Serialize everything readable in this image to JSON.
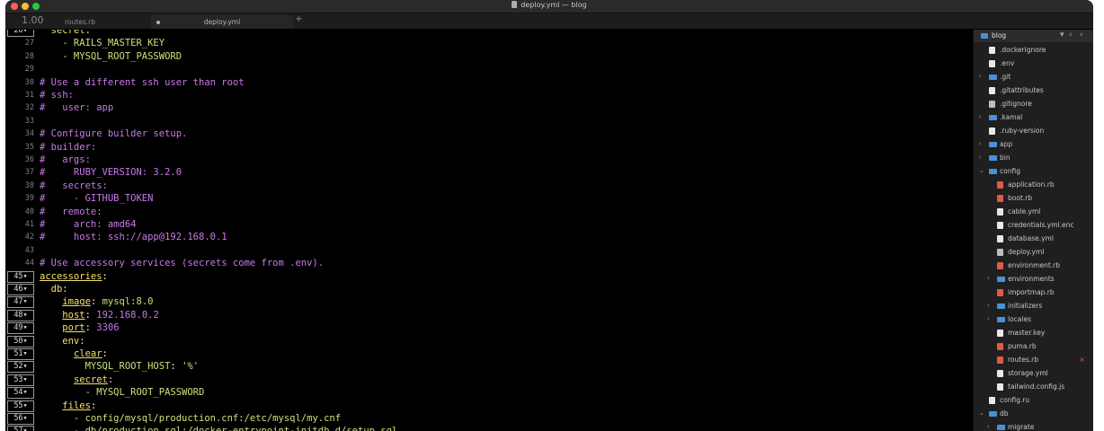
{
  "window": {
    "title": "deploy.yml — blog"
  },
  "tabs": {
    "zoom": "1.00",
    "items": [
      {
        "label": "routes.rb"
      },
      {
        "label": "deploy.yml"
      }
    ],
    "new_tab": "+"
  },
  "editor": {
    "lines": [
      {
        "n": "26",
        "fold": true,
        "segs": [
          {
            "c": "k",
            "t": "  secret"
          },
          {
            "c": "sv",
            "t": ":"
          }
        ]
      },
      {
        "n": "27",
        "segs": [
          {
            "c": "str",
            "t": "    - RAILS_MASTER_KEY"
          }
        ]
      },
      {
        "n": "28",
        "segs": [
          {
            "c": "str",
            "t": "    - MYSQL_ROOT_PASSWORD"
          }
        ]
      },
      {
        "n": "29",
        "segs": []
      },
      {
        "n": "30",
        "segs": [
          {
            "c": "com",
            "t": "# Use a different ssh user than root"
          }
        ]
      },
      {
        "n": "31",
        "segs": [
          {
            "c": "com",
            "t": "# ssh:"
          }
        ]
      },
      {
        "n": "32",
        "segs": [
          {
            "c": "com",
            "t": "#   user: app"
          }
        ]
      },
      {
        "n": "33",
        "segs": []
      },
      {
        "n": "34",
        "segs": [
          {
            "c": "com",
            "t": "# Configure builder setup."
          }
        ]
      },
      {
        "n": "35",
        "segs": [
          {
            "c": "com",
            "t": "# builder:"
          }
        ]
      },
      {
        "n": "36",
        "segs": [
          {
            "c": "com",
            "t": "#   args:"
          }
        ]
      },
      {
        "n": "37",
        "segs": [
          {
            "c": "com",
            "t": "#     RUBY_VERSION: 3.2.0"
          }
        ]
      },
      {
        "n": "38",
        "segs": [
          {
            "c": "com",
            "t": "#   secrets:"
          }
        ]
      },
      {
        "n": "39",
        "segs": [
          {
            "c": "com",
            "t": "#     - GITHUB_TOKEN"
          }
        ]
      },
      {
        "n": "40",
        "segs": [
          {
            "c": "com",
            "t": "#   remote:"
          }
        ]
      },
      {
        "n": "41",
        "segs": [
          {
            "c": "com",
            "t": "#     arch: amd64"
          }
        ]
      },
      {
        "n": "42",
        "segs": [
          {
            "c": "com",
            "t": "#     host: ssh://app@192.168.0.1"
          }
        ]
      },
      {
        "n": "43",
        "segs": []
      },
      {
        "n": "44",
        "segs": [
          {
            "c": "com",
            "t": "# Use accessory services (secrets come from .env)."
          }
        ]
      },
      {
        "n": "45",
        "fold": true,
        "segs": [
          {
            "c": "kk",
            "t": "accessories"
          },
          {
            "c": "sv",
            "t": ":"
          }
        ]
      },
      {
        "n": "46",
        "fold": true,
        "segs": [
          {
            "c": "k",
            "t": "  db"
          },
          {
            "c": "sv",
            "t": ":"
          }
        ]
      },
      {
        "n": "47",
        "fold": true,
        "segs": [
          {
            "c": "sv",
            "t": "    "
          },
          {
            "c": "kk",
            "t": "image"
          },
          {
            "c": "sv",
            "t": ": "
          },
          {
            "c": "str",
            "t": "mysql:8.0"
          }
        ]
      },
      {
        "n": "48",
        "fold": true,
        "segs": [
          {
            "c": "sv",
            "t": "    "
          },
          {
            "c": "kk",
            "t": "host"
          },
          {
            "c": "sv",
            "t": ": "
          },
          {
            "c": "num",
            "t": "192.168.0.2"
          }
        ]
      },
      {
        "n": "49",
        "fold": true,
        "segs": [
          {
            "c": "sv",
            "t": "    "
          },
          {
            "c": "kk",
            "t": "port"
          },
          {
            "c": "sv",
            "t": ": "
          },
          {
            "c": "num",
            "t": "3306"
          }
        ]
      },
      {
        "n": "50",
        "fold": true,
        "segs": [
          {
            "c": "k",
            "t": "    env"
          },
          {
            "c": "sv",
            "t": ":"
          }
        ]
      },
      {
        "n": "51",
        "fold": true,
        "segs": [
          {
            "c": "sv",
            "t": "      "
          },
          {
            "c": "kk",
            "t": "clear"
          },
          {
            "c": "sv",
            "t": ":"
          }
        ]
      },
      {
        "n": "52",
        "fold": true,
        "segs": [
          {
            "c": "str",
            "t": "        MYSQL_ROOT_HOST"
          },
          {
            "c": "sv",
            "t": ": "
          },
          {
            "c": "str",
            "t": "'%'"
          }
        ]
      },
      {
        "n": "53",
        "fold": true,
        "segs": [
          {
            "c": "sv",
            "t": "      "
          },
          {
            "c": "kk",
            "t": "secret"
          },
          {
            "c": "sv",
            "t": ":"
          }
        ]
      },
      {
        "n": "54",
        "fold": true,
        "segs": [
          {
            "c": "str",
            "t": "        - MYSQL_ROOT_PASSWORD"
          }
        ]
      },
      {
        "n": "55",
        "fold": true,
        "segs": [
          {
            "c": "sv",
            "t": "    "
          },
          {
            "c": "kk",
            "t": "files"
          },
          {
            "c": "sv",
            "t": ":"
          }
        ]
      },
      {
        "n": "56",
        "fold": true,
        "segs": [
          {
            "c": "str",
            "t": "      - config/mysql/production.cnf:/etc/mysql/my.cnf"
          }
        ]
      },
      {
        "n": "57",
        "fold": true,
        "segs": [
          {
            "c": "str",
            "t": "      - db/production.sql:/docker-entrypoint-initdb.d/setup.sql"
          }
        ]
      }
    ]
  },
  "sidebar": {
    "project": "blog",
    "items": [
      {
        "label": ".dockerignore",
        "depth": 1,
        "kind": "file"
      },
      {
        "label": ".env",
        "depth": 1,
        "kind": "file"
      },
      {
        "label": ".git",
        "depth": 1,
        "kind": "folder",
        "collapsed": true
      },
      {
        "label": ".gitattributes",
        "depth": 1,
        "kind": "file"
      },
      {
        "label": ".gitignore",
        "depth": 1,
        "kind": "gray"
      },
      {
        "label": ".kamal",
        "depth": 1,
        "kind": "folder",
        "collapsed": true
      },
      {
        "label": ".ruby-version",
        "depth": 1,
        "kind": "file"
      },
      {
        "label": "app",
        "depth": 1,
        "kind": "folder",
        "collapsed": true
      },
      {
        "label": "bin",
        "depth": 1,
        "kind": "folder",
        "collapsed": true
      },
      {
        "label": "config",
        "depth": 1,
        "kind": "folder",
        "expanded": true
      },
      {
        "label": "application.rb",
        "depth": 2,
        "kind": "ruby"
      },
      {
        "label": "boot.rb",
        "depth": 2,
        "kind": "ruby"
      },
      {
        "label": "cable.yml",
        "depth": 2,
        "kind": "file"
      },
      {
        "label": "credentials.yml.enc",
        "depth": 2,
        "kind": "file"
      },
      {
        "label": "database.yml",
        "depth": 2,
        "kind": "file"
      },
      {
        "label": "deploy.yml",
        "depth": 2,
        "kind": "gray",
        "open": true
      },
      {
        "label": "environment.rb",
        "depth": 2,
        "kind": "ruby"
      },
      {
        "label": "environments",
        "depth": 2,
        "kind": "folder",
        "collapsed": true
      },
      {
        "label": "importmap.rb",
        "depth": 2,
        "kind": "ruby"
      },
      {
        "label": "initializers",
        "depth": 2,
        "kind": "folder",
        "collapsed": true
      },
      {
        "label": "locales",
        "depth": 2,
        "kind": "folder",
        "collapsed": true
      },
      {
        "label": "master.key",
        "depth": 2,
        "kind": "file"
      },
      {
        "label": "puma.rb",
        "depth": 2,
        "kind": "ruby"
      },
      {
        "label": "routes.rb",
        "depth": 2,
        "kind": "ruby",
        "closable": true
      },
      {
        "label": "storage.yml",
        "depth": 2,
        "kind": "file"
      },
      {
        "label": "tailwind.config.js",
        "depth": 2,
        "kind": "file"
      },
      {
        "label": "config.ru",
        "depth": 1,
        "kind": "file"
      },
      {
        "label": "db",
        "depth": 1,
        "kind": "folder",
        "expanded": true
      },
      {
        "label": "migrate",
        "depth": 2,
        "kind": "folder",
        "collapsed": true
      }
    ]
  }
}
